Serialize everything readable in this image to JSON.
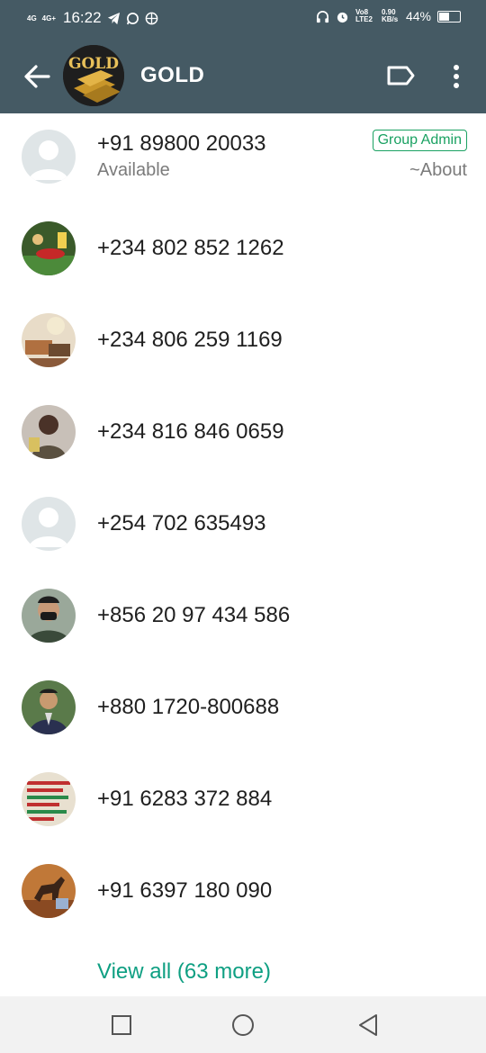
{
  "status_bar": {
    "sim1": "4G",
    "sim2": "4G+",
    "time": "16:22",
    "volte": "Vo8 LTE2",
    "speed": "0.90 KB/s",
    "battery": "44%",
    "battery_level": 0.44
  },
  "header": {
    "title": "GOLD",
    "avatar_text": "GOLD"
  },
  "participants": [
    {
      "phone": "+91 89800 20033",
      "status": "Available",
      "badge": "Group Admin",
      "about": "~About",
      "avatar": "default"
    },
    {
      "phone": "+234 802 852 1262",
      "avatar": "photo-soccer"
    },
    {
      "phone": "+234 806 259 1169",
      "avatar": "photo-room"
    },
    {
      "phone": "+234 816 846 0659",
      "avatar": "photo-person"
    },
    {
      "phone": "+254 702 635493",
      "avatar": "default"
    },
    {
      "phone": "+856 20 97 434 586",
      "avatar": "photo-masked-person"
    },
    {
      "phone": "+880 1720-800688",
      "avatar": "photo-suit-person"
    },
    {
      "phone": "+91 6283 372 884",
      "avatar": "photo-text-poster"
    },
    {
      "phone": "+91 6397 180 090",
      "avatar": "photo-horse"
    }
  ],
  "view_all": "View all (63 more)",
  "colors": {
    "header_bg": "#455a64",
    "accent": "#0e9f82",
    "admin_badge": "#1aa162"
  }
}
